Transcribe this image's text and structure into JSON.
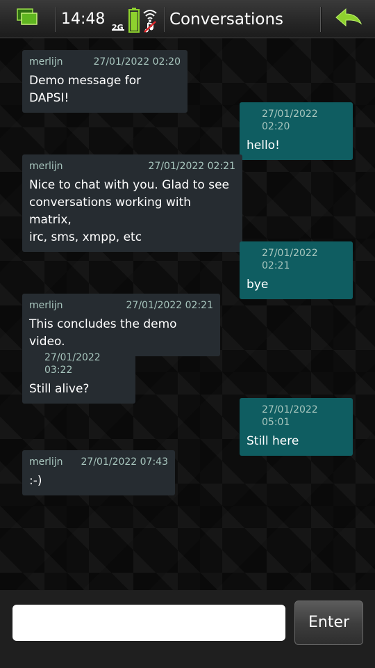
{
  "statusbar": {
    "time": "14:48",
    "network": "2G",
    "task_icon": "task-switcher-icon",
    "battery_icon": "battery-icon",
    "wifi_icon": "wifi-icon",
    "back_icon": "back-arrow-icon",
    "accent_color": "#8ed12e"
  },
  "header": {
    "title": "Conversations"
  },
  "messages": [
    {
      "direction": "in",
      "sender": "merlijn",
      "time": "27/01/2022 02:20",
      "lines": [
        "Demo message for DAPSI!"
      ]
    },
    {
      "direction": "out",
      "sender": "",
      "time": "27/01/2022 02:20",
      "lines": [
        "hello!"
      ]
    },
    {
      "direction": "in",
      "sender": "merlijn",
      "time": "27/01/2022 02:21",
      "lines": [
        "Nice to chat with you. Glad to see",
        "conversations working with matrix,",
        "irc, sms, xmpp, etc"
      ]
    },
    {
      "direction": "out",
      "sender": "",
      "time": "27/01/2022 02:21",
      "lines": [
        "bye"
      ]
    },
    {
      "direction": "in",
      "sender": "merlijn",
      "time": "27/01/2022 02:21",
      "lines": [
        "This concludes the demo video."
      ]
    },
    {
      "direction": "in",
      "sender": "",
      "time": "27/01/2022 03:22",
      "lines": [
        "Still alive?"
      ]
    },
    {
      "direction": "out",
      "sender": "",
      "time": "27/01/2022 05:01",
      "lines": [
        "Still here"
      ]
    },
    {
      "direction": "in",
      "sender": "merlijn",
      "time": "27/01/2022 07:43",
      "lines": [
        ":-)"
      ]
    }
  ],
  "composer": {
    "value": "",
    "placeholder": "",
    "send_label": "Enter"
  },
  "colors": {
    "incoming_bubble": "#262c31",
    "outgoing_bubble": "#0f5d61",
    "meta_text": "#a8c6be"
  }
}
